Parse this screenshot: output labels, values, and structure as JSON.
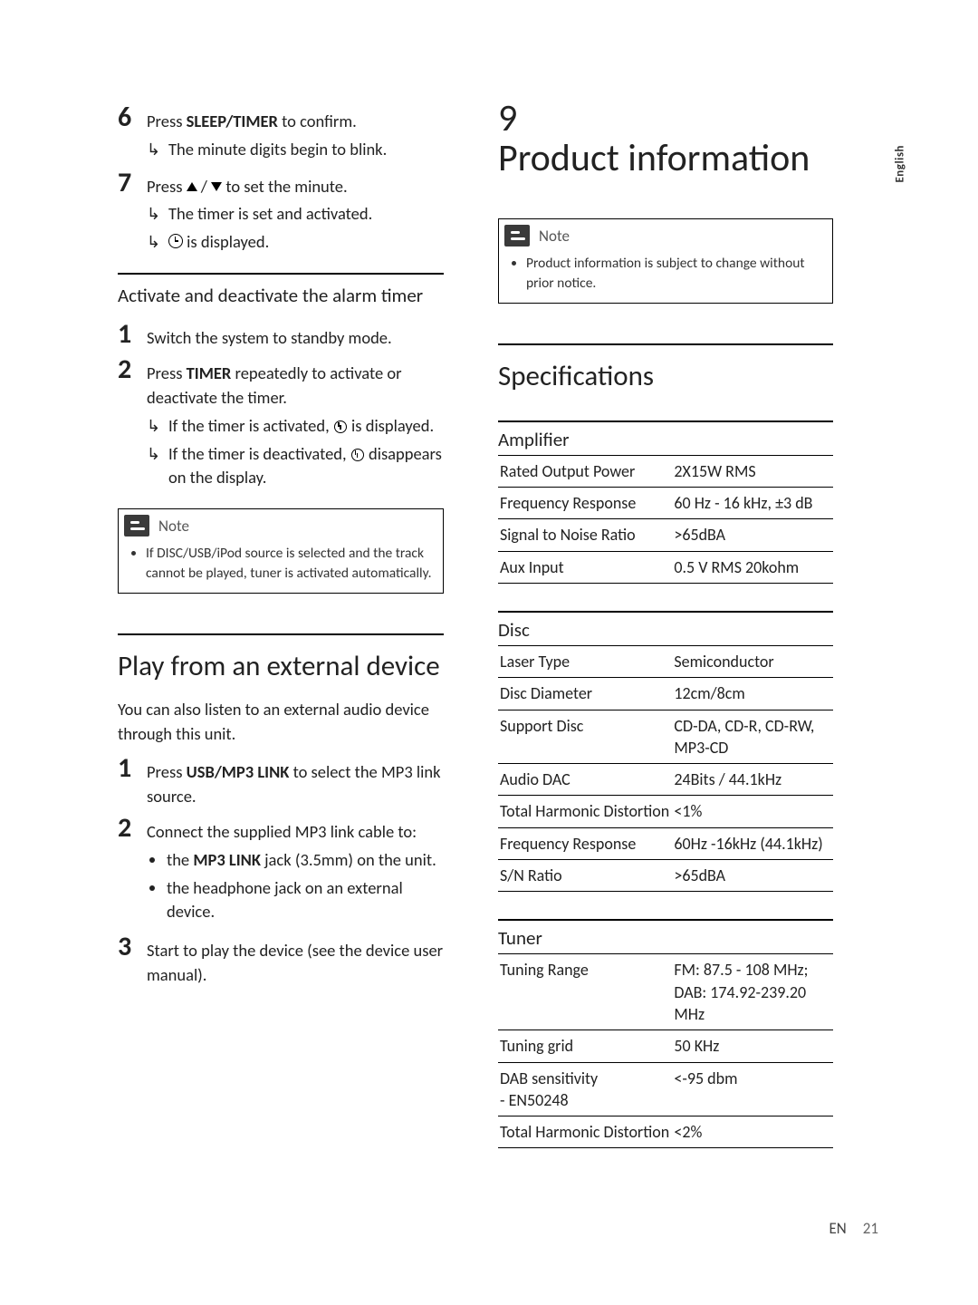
{
  "language_tab": "English",
  "footer": {
    "lang": "EN",
    "page": "21"
  },
  "left": {
    "step6": {
      "num": "6",
      "text_a": "Press ",
      "kw": "SLEEP/TIMER",
      "text_b": " to confirm.",
      "sub1": "The minute digits begin to blink."
    },
    "step7": {
      "num": "7",
      "text_a": "Press ",
      "text_b": " / ",
      "text_c": " to set the minute.",
      "sub1": "The timer is set and activated.",
      "sub2_suffix": " is displayed."
    },
    "alarm_heading": "Activate and deactivate the alarm timer",
    "alarm_step1": {
      "num": "1",
      "text": "Switch the system to standby mode."
    },
    "alarm_step2": {
      "num": "2",
      "text_a": "Press ",
      "kw": "TIMER",
      "text_b": " repeatedly to activate or deactivate the timer.",
      "sub1_a": "If the timer is activated, ",
      "sub1_b": " is displayed.",
      "sub2_a": "If the timer is deactivated, ",
      "sub2_b": " disappears on the display."
    },
    "note1_label": "Note",
    "note1_item": "If DISC/USB/iPod source is selected and the track cannot be played, tuner is activated automatically.",
    "ext_heading": "Play from an external device",
    "ext_intro": "You can also listen to an external audio device through this unit.",
    "ext_step1": {
      "num": "1",
      "text_a": "Press ",
      "kw": "USB/MP3 LINK",
      "text_b": " to select the MP3 link source."
    },
    "ext_step2": {
      "num": "2",
      "text": "Connect the supplied MP3 link cable to:",
      "b1_a": "the ",
      "b1_kw": "MP3 LINK",
      "b1_b": " jack (3.5mm) on the unit.",
      "b2": "the headphone jack on an external device."
    },
    "ext_step3": {
      "num": "3",
      "text": "Start to play the device (see the device user manual)."
    }
  },
  "right": {
    "chapter_num": "9",
    "chapter_title": "Product information",
    "note_label": "Note",
    "note_item": "Product information is subject to change without prior notice.",
    "spec_heading": "Specifications",
    "amplifier": {
      "title": "Amplifier",
      "rows": [
        {
          "k": "Rated Output Power",
          "v": "2X15W RMS"
        },
        {
          "k": "Frequency Response",
          "v": "60 Hz - 16 kHz, ±3 dB"
        },
        {
          "k": "Signal to Noise Ratio",
          "v": ">65dBA"
        },
        {
          "k": "Aux Input",
          "v": "0.5 V RMS 20kohm"
        }
      ]
    },
    "disc": {
      "title": "Disc",
      "rows": [
        {
          "k": "Laser Type",
          "v": "Semiconductor"
        },
        {
          "k": "Disc Diameter",
          "v": "12cm/8cm"
        },
        {
          "k": "Support Disc",
          "v": "CD-DA, CD-R, CD-RW, MP3-CD"
        },
        {
          "k": "Audio DAC",
          "v": "24Bits / 44.1kHz"
        },
        {
          "k": "Total Harmonic Distortion",
          "v": "<1%"
        },
        {
          "k": "Frequency Response",
          "v": "60Hz -16kHz (44.1kHz)"
        },
        {
          "k": "S/N Ratio",
          "v": ">65dBA"
        }
      ]
    },
    "tuner": {
      "title": "Tuner",
      "rows": [
        {
          "k": "Tuning Range",
          "v": "FM: 87.5 - 108 MHz; DAB: 174.92-239.20 MHz"
        },
        {
          "k": "Tuning grid",
          "v": "50 KHz"
        },
        {
          "k": "DAB sensitivity\n- EN50248",
          "v": "<-95 dbm"
        },
        {
          "k": "Total Harmonic Distortion",
          "v": "<2%"
        }
      ]
    }
  }
}
